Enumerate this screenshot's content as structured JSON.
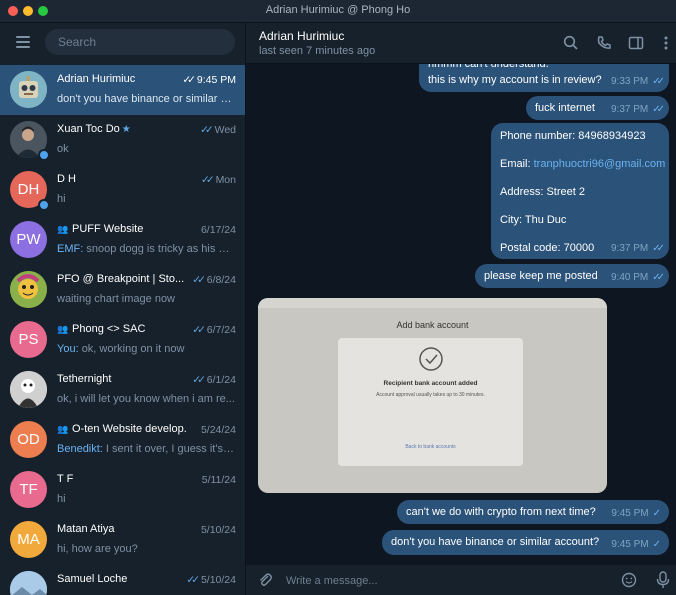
{
  "window": {
    "title": "Adrian Hurimiuc @ Phong Ho"
  },
  "search": {
    "placeholder": "Search"
  },
  "chats": [
    {
      "name": "Adrian Hurimiuc",
      "time": "9:45 PM",
      "preview": "don't you have binance or similar a...",
      "avatar_color": "#64a5d8",
      "read": true
    },
    {
      "name": "Xuan Toc Do",
      "time": "Wed",
      "preview": "ok",
      "avatar_color": "#3a4a56",
      "read": true
    },
    {
      "name": "D H",
      "initials": "DH",
      "time": "Mon",
      "preview": "hi",
      "avatar_color": "#e5675a",
      "read": true
    },
    {
      "name": "PUFF Website",
      "initials": "PW",
      "time": "6/17/24",
      "sender": "EMF: ",
      "preview": "snoop dogg is tricky as his au...",
      "avatar_color": "#8c6fe0",
      "group": true
    },
    {
      "name": "PFO @ Breakpoint | Sto...",
      "time": "6/8/24",
      "preview": "waiting chart image now",
      "avatar_color": "#5a8c3a",
      "read": true
    },
    {
      "name": "Phong <> SAC",
      "initials": "PS",
      "time": "6/7/24",
      "sender": "You: ",
      "preview": "ok, working on it now",
      "avatar_color": "#e86a8f",
      "group": true,
      "read": true
    },
    {
      "name": "Tethernight",
      "time": "6/1/24",
      "preview": "ok, i will let you know when i am re...",
      "avatar_color": "#c9c9c9",
      "read": true
    },
    {
      "name": "O-ten Website develop...",
      "initials": "OD",
      "time": "5/24/24",
      "sender": "Benedikt: ",
      "preview": "I sent it over, I guess it's g...",
      "avatar_color": "#ec7e4f",
      "group": true
    },
    {
      "name": "T F",
      "initials": "TF",
      "time": "5/11/24",
      "preview": "hi",
      "avatar_color": "#e86a8f"
    },
    {
      "name": "Matan Atiya",
      "initials": "MA",
      "time": "5/10/24",
      "preview": "hi, how are you?",
      "avatar_color": "#f2a93b"
    },
    {
      "name": "Samuel Loche",
      "time": "5/10/24",
      "preview": "",
      "avatar_color": "#9bc1e6",
      "read": true
    }
  ],
  "header": {
    "name": "Adrian Hurimiuc",
    "status": "last seen 7 minutes ago"
  },
  "messages": [
    {
      "lines": [
        "hmmm can't understand.",
        "this is why my account is in review?"
      ],
      "time": "9:33 PM"
    },
    {
      "lines": [
        "fuck internet"
      ],
      "time": "9:37 PM"
    },
    {
      "phone": "Phone number: 84968934923",
      "email_label": "Email: ",
      "email": "tranphuoctri96@gmail.com",
      "address": "Address: Street 2",
      "city": "City: Thu Duc",
      "postal": "Postal code: 70000",
      "time": "9:37 PM"
    },
    {
      "lines": [
        "please keep me posted"
      ],
      "time": "9:40 PM"
    },
    {
      "photo": {
        "title": "Add bank account",
        "heading": "Recipient bank account added",
        "body": "Account approval usually takes up to 30 minutes.",
        "link": "Back to bank accounts"
      }
    },
    {
      "lines": [
        "can't we do with crypto from next time?"
      ],
      "time": "9:45 PM"
    },
    {
      "lines": [
        "don't you have binance or similar account?"
      ],
      "time": "9:45 PM"
    }
  ],
  "input": {
    "placeholder": "Write a message..."
  }
}
